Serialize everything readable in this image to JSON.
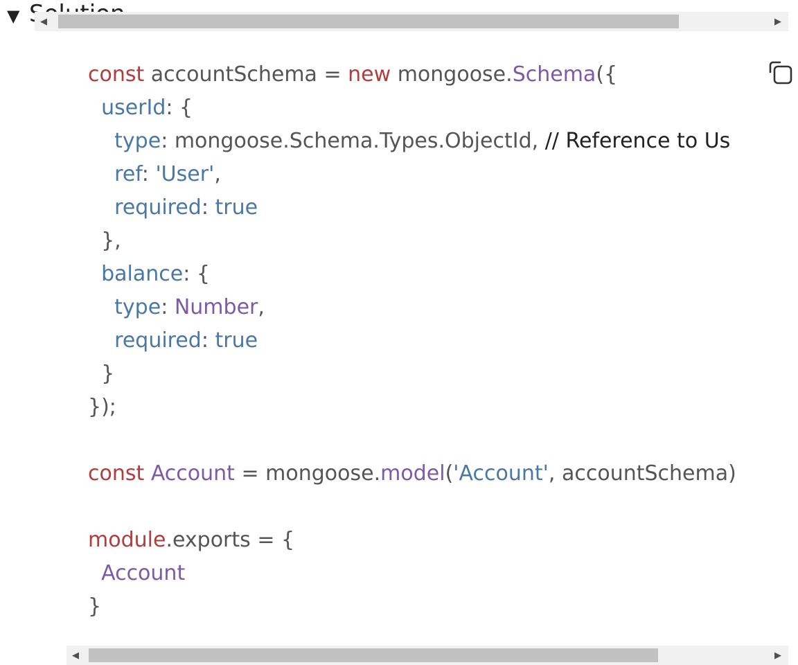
{
  "summary": {
    "label": "Solution"
  },
  "copy_icon": "copy-icon",
  "code_lines": [
    [
      [
        "kw",
        "const"
      ],
      [
        "pl",
        " accountSchema = "
      ],
      [
        "kw",
        "new"
      ],
      [
        "pl",
        " mongoose."
      ],
      [
        "fn",
        "Schema"
      ],
      [
        "pl",
        "({"
      ]
    ],
    [
      [
        "pl",
        "  "
      ],
      [
        "prop",
        "userId"
      ],
      [
        "pl",
        ": {"
      ]
    ],
    [
      [
        "pl",
        "    "
      ],
      [
        "prop",
        "type"
      ],
      [
        "pl",
        ": mongoose.Schema.Types.ObjectId, "
      ],
      [
        "cm",
        "// Reference to Us"
      ]
    ],
    [
      [
        "pl",
        "    "
      ],
      [
        "prop",
        "ref"
      ],
      [
        "pl",
        ": "
      ],
      [
        "str",
        "'User'"
      ],
      [
        "pl",
        ","
      ]
    ],
    [
      [
        "pl",
        "    "
      ],
      [
        "prop",
        "required"
      ],
      [
        "pl",
        ": "
      ],
      [
        "prop",
        "true"
      ]
    ],
    [
      [
        "pl",
        "  },"
      ]
    ],
    [
      [
        "pl",
        "  "
      ],
      [
        "prop",
        "balance"
      ],
      [
        "pl",
        ": {"
      ]
    ],
    [
      [
        "pl",
        "    "
      ],
      [
        "prop",
        "type"
      ],
      [
        "pl",
        ": "
      ],
      [
        "fn",
        "Number"
      ],
      [
        "pl",
        ","
      ]
    ],
    [
      [
        "pl",
        "    "
      ],
      [
        "prop",
        "required"
      ],
      [
        "pl",
        ": "
      ],
      [
        "prop",
        "true"
      ]
    ],
    [
      [
        "pl",
        "  }"
      ]
    ],
    [
      [
        "pl",
        "});"
      ]
    ],
    [
      [
        "pl",
        ""
      ]
    ],
    [
      [
        "kw",
        "const"
      ],
      [
        "pl",
        " "
      ],
      [
        "fn",
        "Account"
      ],
      [
        "pl",
        " = mongoose."
      ],
      [
        "fn",
        "model"
      ],
      [
        "pl",
        "("
      ],
      [
        "str",
        "'Account'"
      ],
      [
        "pl",
        ", accountSchema)"
      ]
    ],
    [
      [
        "pl",
        ""
      ]
    ],
    [
      [
        "kw",
        "module"
      ],
      [
        "pl",
        ".exports = {"
      ]
    ],
    [
      [
        "pl",
        "  "
      ],
      [
        "fn",
        "Account"
      ]
    ],
    [
      [
        "pl",
        "}"
      ]
    ]
  ]
}
